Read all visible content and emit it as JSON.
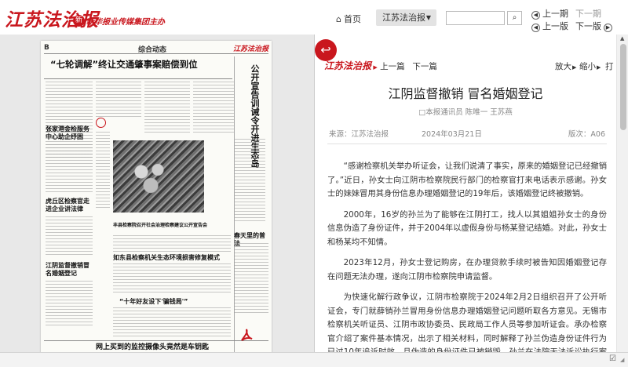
{
  "header": {
    "masthead": "江苏法治报",
    "group_badge": "新",
    "group_name": "新华报业传媒集团主办",
    "home_icon": "home-icon",
    "home_label": "首页",
    "edition_select": "江苏法治报",
    "search": {
      "value": "",
      "placeholder": "",
      "button_icon": "search-icon"
    },
    "nav": {
      "prev_issue": "上一期",
      "next_issue": "下一期",
      "prev_page": "上一版",
      "next_page": "下一版"
    }
  },
  "newspaper_page": {
    "page_letter": "B",
    "section": "综合动态",
    "masthead": "江苏法治报",
    "headline": "“七轮调解”终让交通肇事案赔偿到位",
    "headline2": "",
    "side_headline": "公开宣告训诫令开进生态岛",
    "head_service": "张家港金检服务中心助企纾困",
    "head_law": "虎丘区检察官走进企业讲法律",
    "head_public": "江阴监督撤销冒名婚姻登记",
    "head_env": "如东县检察机关生态环境损害修复模式",
    "head_spring": "春天里的普法",
    "head_ten": "“十年好友设下'骗钱局'”",
    "head_bottom": "网上买到的监控摄像头竟然是车钥匙",
    "mid_headline": "丰县检察院召开社会治理检察建议公开宣告会",
    "pdf_icon": "pdf-icon"
  },
  "article": {
    "back_icon": "back-arrow-icon",
    "masthead": "江苏法治报",
    "prev": "上一篇",
    "next": "下一篇",
    "zoom_in": "放大",
    "zoom_out": "缩小",
    "print": "打",
    "title": "江阴监督撤销 冒名婚姻登记",
    "byline": "□本报通讯员 陈唯一 王苏燕",
    "source": "来源：江苏法治报",
    "date": "2024年03月21日",
    "edition": "版次：A06",
    "paragraphs": [
      "“感谢检察机关举办听证会，让我们说清了事实，原来的婚姻登记已经撤销了。”近日，孙女士向江阴市检察院民行部门的检察官打来电话表示感谢。孙女士的妹妹冒用其身份信息办理婚姻登记的19年后，该婚姻登记终被撤销。",
      "2000年，16岁的孙兰为了能够在江阴打工，找人以其姐姐孙女士的身份信息伪造了身份证件，并于2004年以虚假身份与杨某登记结婚。对此，孙女士和杨某均不知情。",
      "2023年12月，孙女士登记购房，在办理贷款手续时被告知因婚姻登记存在问题无法办理，遂向江阴市检察院申请监督。",
      "为快速化解行政争议，江阴市检察院于2024年2月2日组织召开了公开听证会，专门就薛销孙兰冒用身份信息办理婚姻登记问题听取各方意见。无锡市检察机关听证员、江阴市政协委员、民政局工作人员等参加听证会。承办检察官介绍了案件基本情况，出示了相关材料，同时解释了孙兰伪造身份证件行为已过10年追诉时效，且伪造的身份证件已被销毁，孙兰在法院无法诉讼执行案件，撤销该婚姻登记"
    ],
    "scroll_up_icon": "scroll-up-icon",
    "scroll_down_icon": "scroll-down-icon"
  },
  "status": {
    "check_icon": "check-icon",
    "grip_icon": "resize-grip-icon"
  },
  "colors": {
    "brand_red": "#c9171e",
    "pane_gray": "#e8e8e8"
  }
}
